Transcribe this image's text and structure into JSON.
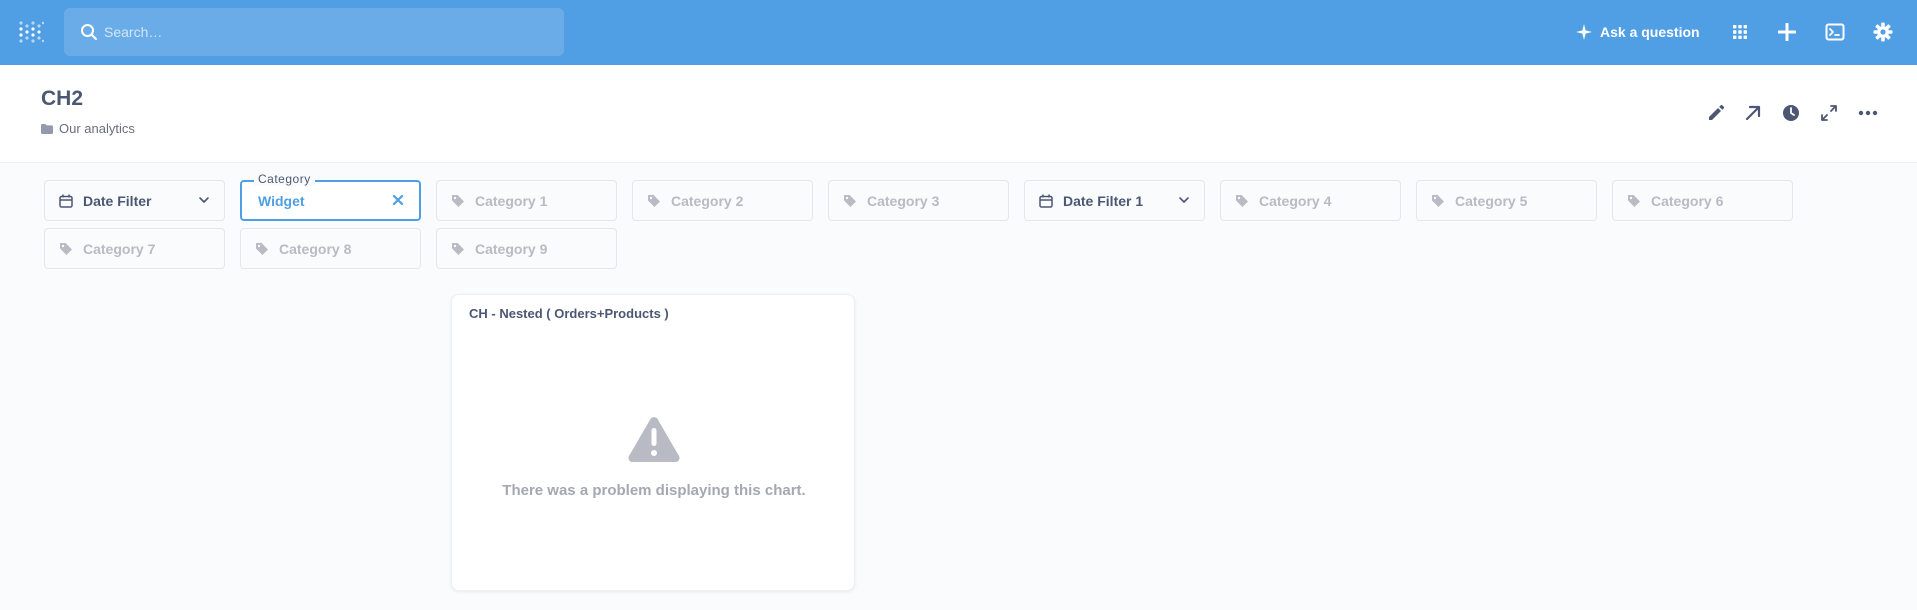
{
  "nav": {
    "search_placeholder": "Search…",
    "ask_label": "Ask a question",
    "brand_color": "#509ee3",
    "icons": [
      "metabase-logo-icon",
      "search-icon",
      "sparkle-icon",
      "apps-grid-icon",
      "plus-icon",
      "sql-editor-icon",
      "gear-icon"
    ]
  },
  "dashboard": {
    "title": "CH2",
    "collection": "Our analytics",
    "actions": [
      "pencil-icon",
      "share-arrow-icon",
      "history-clock-icon",
      "fullscreen-icon",
      "more-dots-icon"
    ]
  },
  "filters": [
    {
      "label": "Date Filter",
      "type": "date"
    },
    {
      "label": "Category",
      "value": "Widget",
      "type": "active"
    },
    {
      "label": "Category 1",
      "type": "category"
    },
    {
      "label": "Category 2",
      "type": "category"
    },
    {
      "label": "Category 3",
      "type": "category"
    },
    {
      "label": "Date Filter 1",
      "type": "date"
    },
    {
      "label": "Category 4",
      "type": "category"
    },
    {
      "label": "Category 5",
      "type": "category"
    },
    {
      "label": "Category 6",
      "type": "category"
    },
    {
      "label": "Category 7",
      "type": "category"
    },
    {
      "label": "Category 8",
      "type": "category"
    },
    {
      "label": "Category 9",
      "type": "category"
    }
  ],
  "card": {
    "title": "CH - Nested ( Orders+Products )",
    "error_message": "There was a problem displaying this chart."
  }
}
